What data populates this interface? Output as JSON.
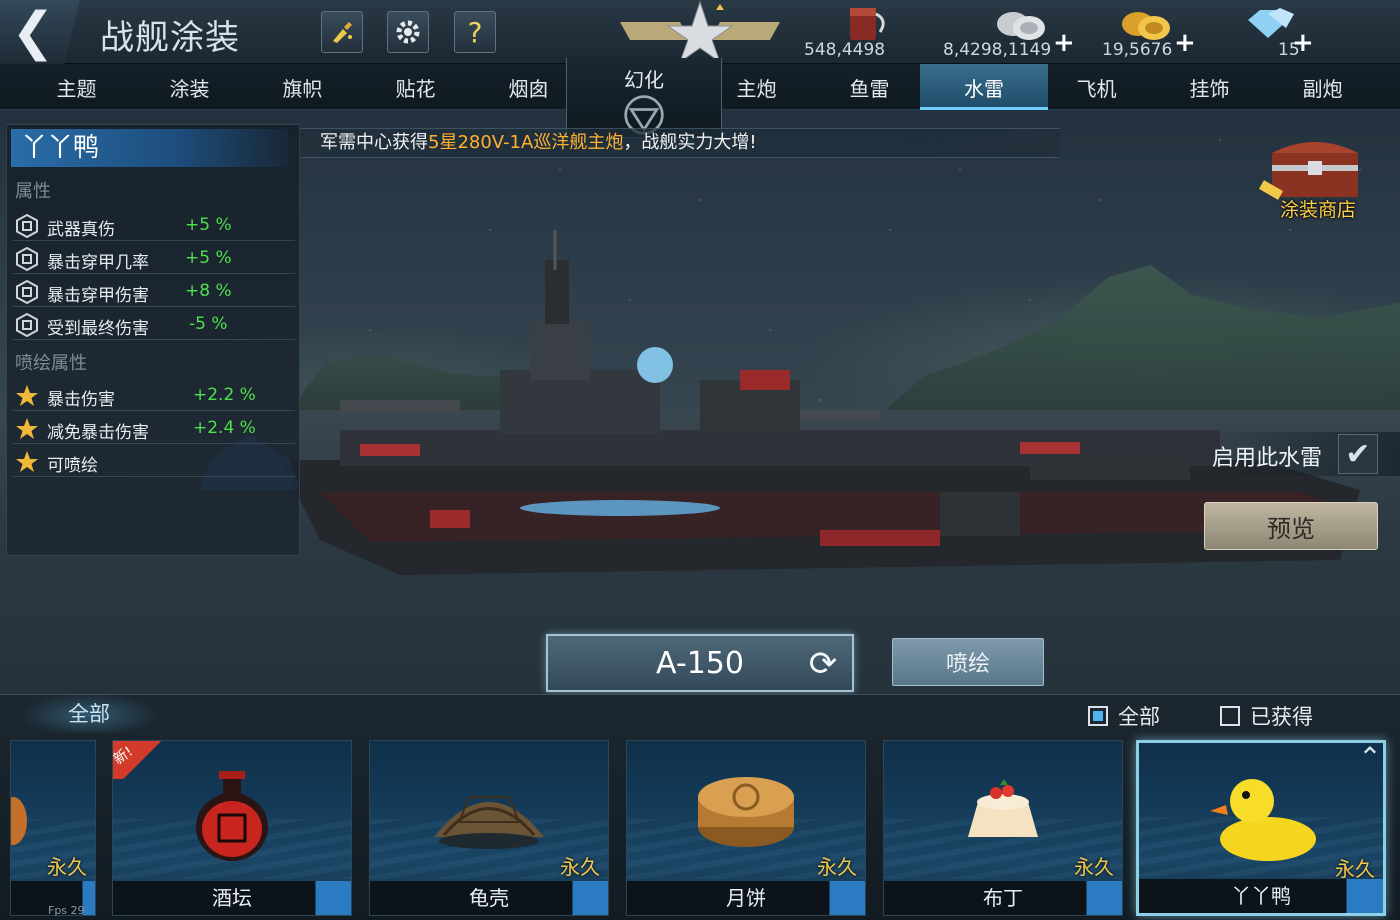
{
  "header": {
    "back_icon": "back-arrow-icon",
    "title": "战舰涂装",
    "buttons": [
      {
        "icon": "paint-brush-icon"
      },
      {
        "icon": "gear-icon"
      },
      {
        "icon": "help-icon",
        "label": "?"
      }
    ],
    "emblem_icon": "rank-star-emblem-icon",
    "resources": [
      {
        "icon": "paint-bucket-icon",
        "value": "548,4498",
        "has_plus": false
      },
      {
        "icon": "silver-coins-icon",
        "value": "8,4298,1149",
        "has_plus": true
      },
      {
        "icon": "gold-coins-icon",
        "value": "19,5676",
        "has_plus": true
      },
      {
        "icon": "diamond-icon",
        "value": "15",
        "has_plus": true
      }
    ],
    "plus_label": "+"
  },
  "tabs": {
    "left": [
      "主题",
      "涂装",
      "旗帜",
      "贴花",
      "烟囱"
    ],
    "center": "幻化",
    "right": [
      "主炮",
      "鱼雷",
      "水雷",
      "飞机",
      "挂饰",
      "副炮"
    ],
    "active": "水雷"
  },
  "banner": {
    "prefix": "军需中心获得",
    "highlight": "5星280V-1A巡洋舰主炮",
    "suffix": "，战舰实力大增!"
  },
  "left_panel": {
    "title": "丫丫鸭",
    "section_attributes": "属性",
    "attributes": [
      {
        "name": "武器真伤",
        "value": "+5 %"
      },
      {
        "name": "暴击穿甲几率",
        "value": "+5 %"
      },
      {
        "name": "暴击穿甲伤害",
        "value": "+8 %"
      },
      {
        "name": "受到最终伤害",
        "value": "-5 %"
      }
    ],
    "section_spray": "喷绘属性",
    "spray_attributes": [
      {
        "name": "暴击伤害",
        "value": "+2.2 %"
      },
      {
        "name": "减免暴击伤害",
        "value": "+2.4 %"
      },
      {
        "name": "可喷绘",
        "value": ""
      }
    ]
  },
  "right_controls": {
    "shop_label": "涂装商店",
    "enable_label": "启用此水雷",
    "enable_checked": true,
    "preview_label": "预览"
  },
  "center_controls": {
    "ship_name": "A-150",
    "spray_label": "喷绘"
  },
  "bottom": {
    "filter_tab": "全部",
    "filter_all_label": "全部",
    "filter_all_checked": true,
    "filter_owned_label": "已获得",
    "filter_owned_checked": false,
    "cards": [
      {
        "name": "",
        "duration": "永久",
        "icon": "partial-item-icon",
        "new": false
      },
      {
        "name": "酒坛",
        "duration": "永久",
        "icon": "wine-jar-icon",
        "new": true,
        "new_label": "新!"
      },
      {
        "name": "龟壳",
        "duration": "永久",
        "icon": "turtle-shell-icon",
        "new": false
      },
      {
        "name": "月饼",
        "duration": "永久",
        "icon": "mooncake-icon",
        "new": false
      },
      {
        "name": "布丁",
        "duration": "永久",
        "icon": "pudding-icon",
        "new": false
      },
      {
        "name": "丫丫鸭",
        "duration": "永久",
        "icon": "rubber-duck-icon",
        "new": false,
        "selected": true
      }
    ],
    "fps": "Fps 29"
  },
  "colors": {
    "accent_blue": "#2b7bc3",
    "positive_green": "#4ee04e",
    "gold": "#f2c64a",
    "banner_highlight": "#ffb12e"
  }
}
